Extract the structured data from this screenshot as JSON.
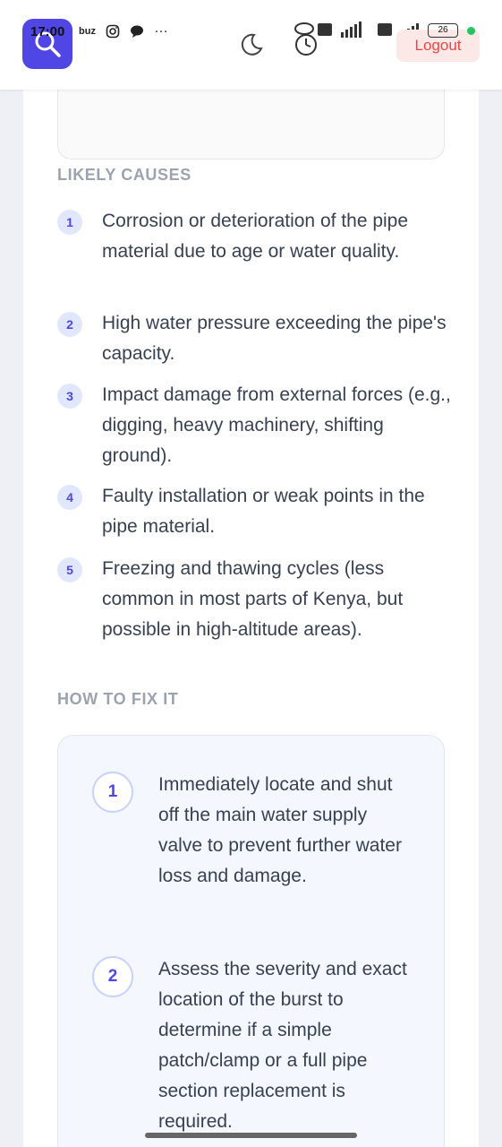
{
  "status_bar": {
    "time": "17:00",
    "app_label": "buz",
    "more": "…",
    "battery": "26"
  },
  "header": {
    "logout_label": "Logout"
  },
  "likely_causes": {
    "title": "LIKELY CAUSES",
    "items": [
      {
        "num": "1",
        "text": "Corrosion or deterioration of the pipe material due to age or water quality."
      },
      {
        "num": "2",
        "text": "High water pressure exceeding the pipe's capacity."
      },
      {
        "num": "3",
        "text": "Impact damage from external forces (e.g., digging, heavy machinery, shifting ground)."
      },
      {
        "num": "4",
        "text": "Faulty installation or weak points in the pipe material."
      },
      {
        "num": "5",
        "text": "Freezing and thawing cycles (less common in most parts of Kenya, but possible in high-altitude areas)."
      }
    ]
  },
  "how_to_fix": {
    "title": "HOW TO FIX IT",
    "steps": [
      {
        "num": "1",
        "text": "Immediately locate and shut off the main water supply valve to prevent further water loss and damage."
      },
      {
        "num": "2",
        "text": "Assess the severity and exact location of the burst to determine if a simple patch/clamp or a full pipe section replacement is required."
      }
    ]
  },
  "colors": {
    "accent": "#4f46e5",
    "logout": "#ef4444"
  }
}
